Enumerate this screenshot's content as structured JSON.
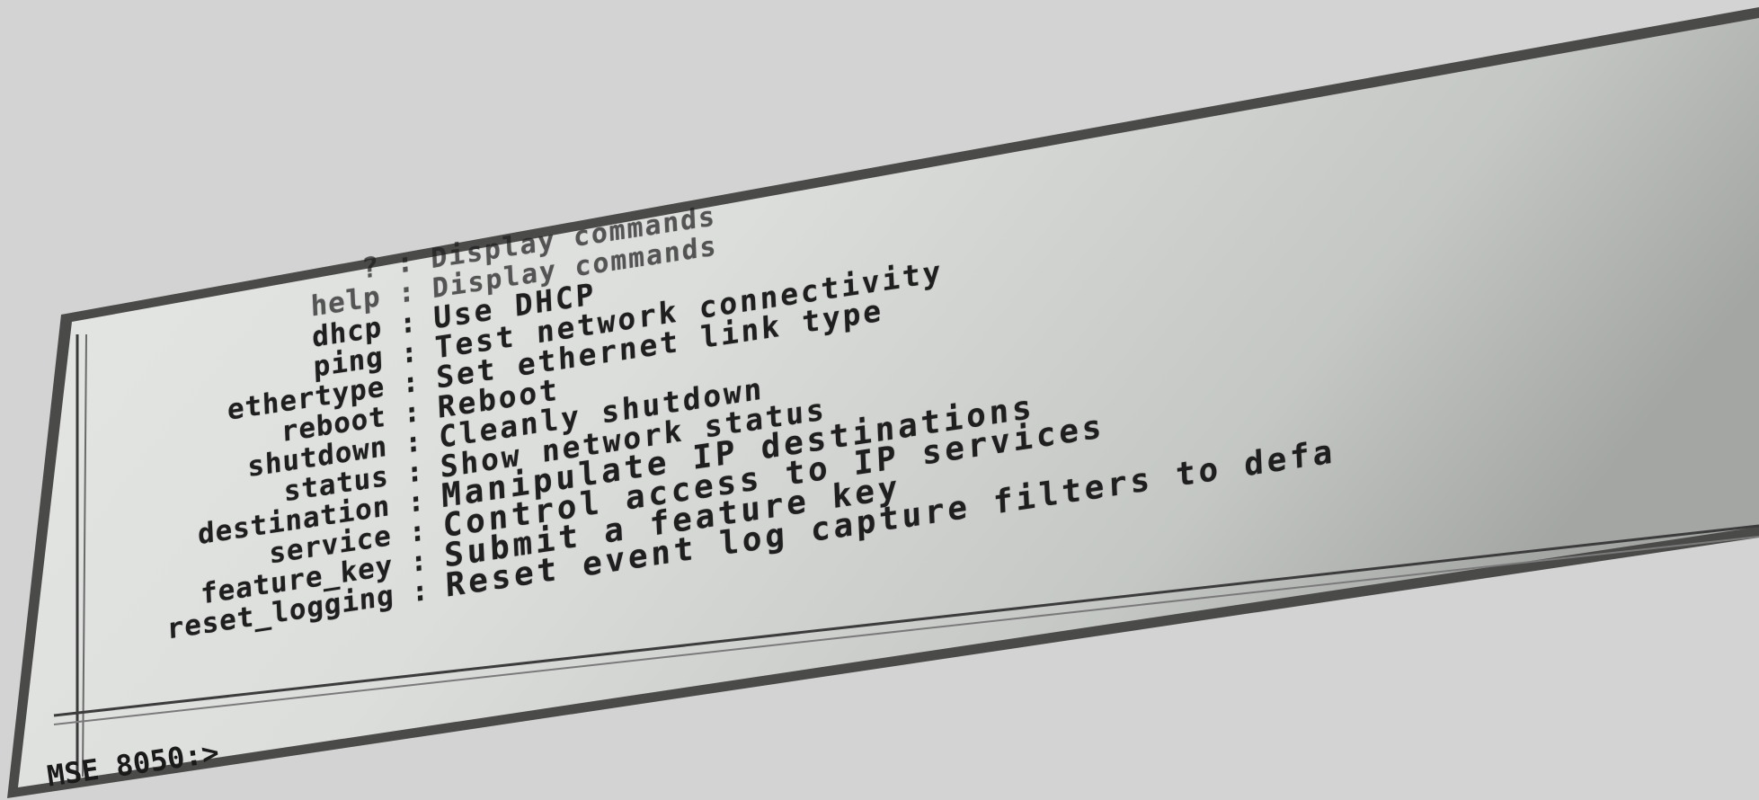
{
  "terminal": {
    "commands": [
      {
        "name": "?",
        "separator": ":",
        "description": "Display commands"
      },
      {
        "name": "help",
        "separator": ":",
        "description": "Display commands"
      },
      {
        "name": "dhcp",
        "separator": ":",
        "description": "Use DHCP"
      },
      {
        "name": "ping",
        "separator": ":",
        "description": "Test network connectivity"
      },
      {
        "name": "ethertype",
        "separator": ":",
        "description": "Set ethernet link type"
      },
      {
        "name": "reboot",
        "separator": ":",
        "description": "Reboot"
      },
      {
        "name": "shutdown",
        "separator": ":",
        "description": "Cleanly shutdown"
      },
      {
        "name": "status",
        "separator": ":",
        "description": "Show network status"
      },
      {
        "name": "destination",
        "separator": ":",
        "description": "Manipulate IP destinations"
      },
      {
        "name": "service",
        "separator": ":",
        "description": "Control access to IP services"
      },
      {
        "name": "feature_key",
        "separator": ":",
        "description": "Submit a feature key"
      },
      {
        "name": "reset_logging",
        "separator": ":",
        "description": "Reset event log capture filters to defa"
      }
    ],
    "prompt": "MSE 8050:>"
  },
  "colors": {
    "background": "#d3d3d3",
    "screen_bezel": "#4a4a48",
    "screen_light": "#e4e6e4",
    "screen_dark": "#9c9f9c",
    "text": "#1f1f1f"
  }
}
